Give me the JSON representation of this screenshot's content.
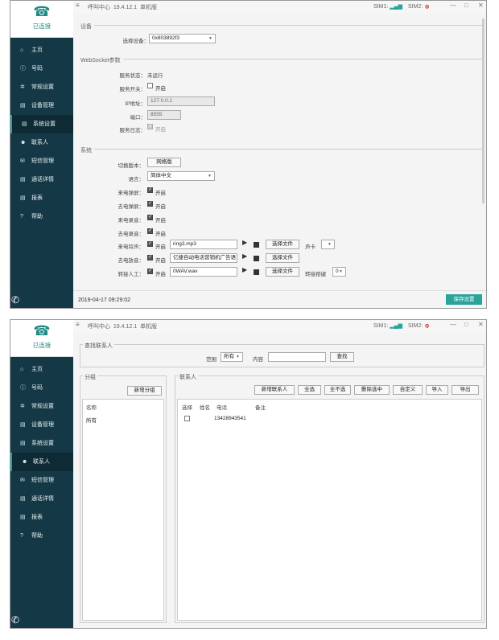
{
  "app": {
    "title": "呼叫中心",
    "version": "19.4.12.1",
    "edition": "单机版",
    "sim1": "SIM1:",
    "sim2": "SIM2:",
    "connected": "已连接"
  },
  "nav": [
    "主页",
    "号码",
    "常规设置",
    "设备管理",
    "系统设置",
    "联系人",
    "短信管理",
    "通话详情",
    "报表",
    "帮助"
  ],
  "nav_icons": [
    "home-icon",
    "info-icon",
    "gear-icon",
    "list-icon",
    "list-icon",
    "user-icon",
    "mail-icon",
    "list-icon",
    "list-icon",
    "help-icon"
  ],
  "settings": {
    "device_group": "设备",
    "device_label": "选择设备：",
    "device_value": "0x803892f3",
    "ws_group": "WebSocket参数",
    "ws_status_label": "服务状态：",
    "ws_status_value": "未运行",
    "ws_switch_label": "服务开关：",
    "ws_switch_text": "开启",
    "ip_label": "IP地址：",
    "ip_value": "127.0.0.1",
    "port_label": "端口：",
    "port_value": "8555",
    "log_label": "服务日志：",
    "log_text": "开启",
    "sys_group": "系统",
    "version_switch_label": "切换版本：",
    "version_switch_button": "网络版",
    "lang_label": "语言：",
    "lang_value": "简体中文",
    "incoming_popup_label": "来电弹屏：",
    "incoming_popup_text": "开启",
    "outgoing_popup_label": "去电弹屏：",
    "outgoing_popup_text": "开启",
    "incoming_rec_label": "来电录音：",
    "incoming_rec_text": "开启",
    "outgoing_rec_label": "去电录音：",
    "outgoing_rec_text": "开启",
    "ring_label": "来电铃声：",
    "ring_text": "开启",
    "ring_file": "ring3.mp3",
    "ring_choose": "选择文件",
    "soundcard_label": "声卡",
    "out_audio_label": "去电放音：",
    "out_audio_text": "开启",
    "out_audio_file": "亿捷自动电话营销机广告语",
    "out_audio_choose": "选择文件",
    "transfer_label": "转接人工：",
    "transfer_text": "开启",
    "transfer_file": "0WAV.wav",
    "transfer_choose": "选择文件",
    "transfer_key_label": "转接按键",
    "transfer_key_value": "0",
    "timestamp": "2019-04-17 09:29:02",
    "save_button": "保存设置"
  },
  "contacts": {
    "search_group": "查找联系人",
    "range_label": "范围",
    "range_value": "所有",
    "content_label": "内容",
    "content_value": "",
    "search_button": "查找",
    "group_panel": "分组",
    "add_group_button": "新增分组",
    "group_col": "名称",
    "groups": [
      "所有"
    ],
    "contact_panel": "联系人",
    "buttons": [
      "新增联系人",
      "全选",
      "全不选",
      "删除选中",
      "自定义",
      "导入",
      "导出"
    ],
    "columns": [
      "选择",
      "姓名",
      "电话",
      "备注"
    ],
    "rows": [
      {
        "name": "",
        "phone": "13428943541",
        "note": ""
      }
    ]
  }
}
